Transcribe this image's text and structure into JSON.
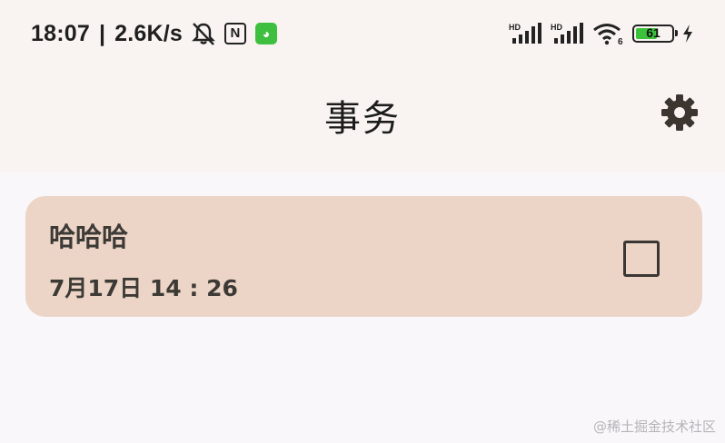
{
  "status_bar": {
    "time": "18:07",
    "separator": "|",
    "speed": "2.6K/s",
    "icons": [
      "bell-off-icon",
      "nfc-icon",
      "app-icon",
      "signal-hd-icon",
      "signal-hd-icon",
      "wifi-icon",
      "battery-icon",
      "charging-icon"
    ],
    "nfc_glyph": "N",
    "hd_label": "HD",
    "wifi_badge": "6",
    "battery_level": "61",
    "battery_fraction": 0.61,
    "battery_color": "#3bc23b"
  },
  "header": {
    "title": "事务",
    "settings_icon": "gear-icon"
  },
  "tasks": [
    {
      "title": "哈哈哈",
      "time": "7月17日 14 : 26",
      "checked": false,
      "bg": "#ecd5c7"
    }
  ],
  "watermark": "@稀土掘金技术社区"
}
